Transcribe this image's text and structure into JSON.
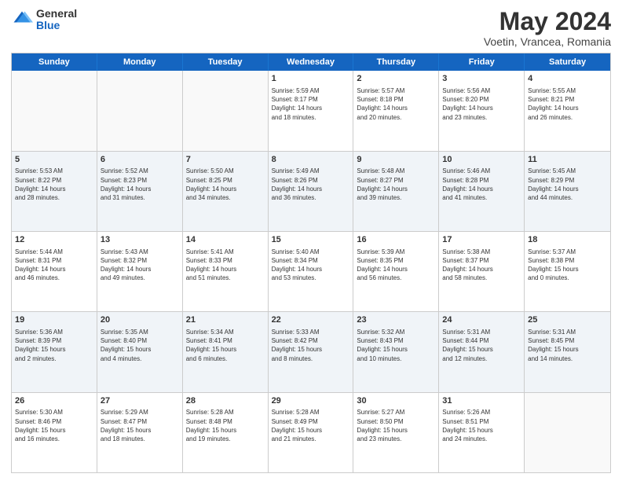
{
  "header": {
    "logo_general": "General",
    "logo_blue": "Blue",
    "month_title": "May 2024",
    "location": "Voetin, Vrancea, Romania"
  },
  "days_of_week": [
    "Sunday",
    "Monday",
    "Tuesday",
    "Wednesday",
    "Thursday",
    "Friday",
    "Saturday"
  ],
  "rows": [
    [
      {
        "day": "",
        "info": "",
        "empty": true
      },
      {
        "day": "",
        "info": "",
        "empty": true
      },
      {
        "day": "",
        "info": "",
        "empty": true
      },
      {
        "day": "1",
        "info": "Sunrise: 5:59 AM\nSunset: 8:17 PM\nDaylight: 14 hours\nand 18 minutes.",
        "empty": false
      },
      {
        "day": "2",
        "info": "Sunrise: 5:57 AM\nSunset: 8:18 PM\nDaylight: 14 hours\nand 20 minutes.",
        "empty": false
      },
      {
        "day": "3",
        "info": "Sunrise: 5:56 AM\nSunset: 8:20 PM\nDaylight: 14 hours\nand 23 minutes.",
        "empty": false
      },
      {
        "day": "4",
        "info": "Sunrise: 5:55 AM\nSunset: 8:21 PM\nDaylight: 14 hours\nand 26 minutes.",
        "empty": false
      }
    ],
    [
      {
        "day": "5",
        "info": "Sunrise: 5:53 AM\nSunset: 8:22 PM\nDaylight: 14 hours\nand 28 minutes.",
        "empty": false
      },
      {
        "day": "6",
        "info": "Sunrise: 5:52 AM\nSunset: 8:23 PM\nDaylight: 14 hours\nand 31 minutes.",
        "empty": false
      },
      {
        "day": "7",
        "info": "Sunrise: 5:50 AM\nSunset: 8:25 PM\nDaylight: 14 hours\nand 34 minutes.",
        "empty": false
      },
      {
        "day": "8",
        "info": "Sunrise: 5:49 AM\nSunset: 8:26 PM\nDaylight: 14 hours\nand 36 minutes.",
        "empty": false
      },
      {
        "day": "9",
        "info": "Sunrise: 5:48 AM\nSunset: 8:27 PM\nDaylight: 14 hours\nand 39 minutes.",
        "empty": false
      },
      {
        "day": "10",
        "info": "Sunrise: 5:46 AM\nSunset: 8:28 PM\nDaylight: 14 hours\nand 41 minutes.",
        "empty": false
      },
      {
        "day": "11",
        "info": "Sunrise: 5:45 AM\nSunset: 8:29 PM\nDaylight: 14 hours\nand 44 minutes.",
        "empty": false
      }
    ],
    [
      {
        "day": "12",
        "info": "Sunrise: 5:44 AM\nSunset: 8:31 PM\nDaylight: 14 hours\nand 46 minutes.",
        "empty": false
      },
      {
        "day": "13",
        "info": "Sunrise: 5:43 AM\nSunset: 8:32 PM\nDaylight: 14 hours\nand 49 minutes.",
        "empty": false
      },
      {
        "day": "14",
        "info": "Sunrise: 5:41 AM\nSunset: 8:33 PM\nDaylight: 14 hours\nand 51 minutes.",
        "empty": false
      },
      {
        "day": "15",
        "info": "Sunrise: 5:40 AM\nSunset: 8:34 PM\nDaylight: 14 hours\nand 53 minutes.",
        "empty": false
      },
      {
        "day": "16",
        "info": "Sunrise: 5:39 AM\nSunset: 8:35 PM\nDaylight: 14 hours\nand 56 minutes.",
        "empty": false
      },
      {
        "day": "17",
        "info": "Sunrise: 5:38 AM\nSunset: 8:37 PM\nDaylight: 14 hours\nand 58 minutes.",
        "empty": false
      },
      {
        "day": "18",
        "info": "Sunrise: 5:37 AM\nSunset: 8:38 PM\nDaylight: 15 hours\nand 0 minutes.",
        "empty": false
      }
    ],
    [
      {
        "day": "19",
        "info": "Sunrise: 5:36 AM\nSunset: 8:39 PM\nDaylight: 15 hours\nand 2 minutes.",
        "empty": false
      },
      {
        "day": "20",
        "info": "Sunrise: 5:35 AM\nSunset: 8:40 PM\nDaylight: 15 hours\nand 4 minutes.",
        "empty": false
      },
      {
        "day": "21",
        "info": "Sunrise: 5:34 AM\nSunset: 8:41 PM\nDaylight: 15 hours\nand 6 minutes.",
        "empty": false
      },
      {
        "day": "22",
        "info": "Sunrise: 5:33 AM\nSunset: 8:42 PM\nDaylight: 15 hours\nand 8 minutes.",
        "empty": false
      },
      {
        "day": "23",
        "info": "Sunrise: 5:32 AM\nSunset: 8:43 PM\nDaylight: 15 hours\nand 10 minutes.",
        "empty": false
      },
      {
        "day": "24",
        "info": "Sunrise: 5:31 AM\nSunset: 8:44 PM\nDaylight: 15 hours\nand 12 minutes.",
        "empty": false
      },
      {
        "day": "25",
        "info": "Sunrise: 5:31 AM\nSunset: 8:45 PM\nDaylight: 15 hours\nand 14 minutes.",
        "empty": false
      }
    ],
    [
      {
        "day": "26",
        "info": "Sunrise: 5:30 AM\nSunset: 8:46 PM\nDaylight: 15 hours\nand 16 minutes.",
        "empty": false
      },
      {
        "day": "27",
        "info": "Sunrise: 5:29 AM\nSunset: 8:47 PM\nDaylight: 15 hours\nand 18 minutes.",
        "empty": false
      },
      {
        "day": "28",
        "info": "Sunrise: 5:28 AM\nSunset: 8:48 PM\nDaylight: 15 hours\nand 19 minutes.",
        "empty": false
      },
      {
        "day": "29",
        "info": "Sunrise: 5:28 AM\nSunset: 8:49 PM\nDaylight: 15 hours\nand 21 minutes.",
        "empty": false
      },
      {
        "day": "30",
        "info": "Sunrise: 5:27 AM\nSunset: 8:50 PM\nDaylight: 15 hours\nand 23 minutes.",
        "empty": false
      },
      {
        "day": "31",
        "info": "Sunrise: 5:26 AM\nSunset: 8:51 PM\nDaylight: 15 hours\nand 24 minutes.",
        "empty": false
      },
      {
        "day": "",
        "info": "",
        "empty": true
      }
    ]
  ]
}
